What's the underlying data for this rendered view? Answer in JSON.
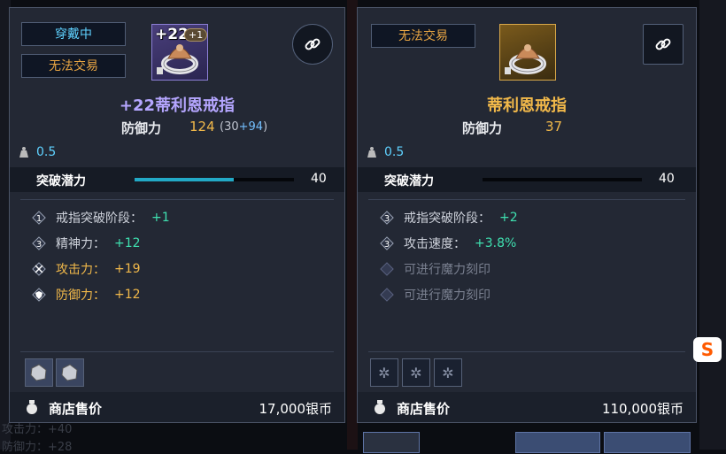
{
  "left_panel": {
    "badge_equipped": "穿戴中",
    "badge_no_trade": "无法交易",
    "icon_enhance": "+22",
    "icon_extra": "+1",
    "item_name": "+22蒂利恩戒指",
    "defense_label": "防御力",
    "defense_value": "124",
    "defense_base": "(30",
    "defense_bonus": "+94",
    "defense_close": ")",
    "weight": "0.5",
    "breakthrough_label": "突破潜力",
    "breakthrough_value": "40",
    "breakthrough_fill": 0.62,
    "options": [
      {
        "icon": "1",
        "label": "戒指突破阶段：",
        "value": "+1"
      },
      {
        "icon": "3",
        "label": "精神力：",
        "value": "+12"
      },
      {
        "icon": "attack-icon",
        "label": "攻击力：",
        "value": "+19"
      },
      {
        "icon": "shield-icon",
        "label": "防御力：",
        "value": "+12"
      }
    ],
    "price_label": "商店售价",
    "price_value": "17,000银币"
  },
  "right_panel": {
    "badge_no_trade": "无法交易",
    "item_name": "蒂利恩戒指",
    "defense_label": "防御力",
    "defense_value": "37",
    "weight": "0.5",
    "breakthrough_label": "突破潜力",
    "breakthrough_value": "40",
    "breakthrough_fill": 0,
    "options": [
      {
        "icon": "3",
        "label": "戒指突破阶段：",
        "value": "+2"
      },
      {
        "icon": "3",
        "label": "攻击速度：",
        "value": "+3.8%"
      },
      {
        "icon": "empty-diamond-icon",
        "label": "可进行魔力刻印",
        "value": ""
      },
      {
        "icon": "empty-diamond-icon",
        "label": "可进行魔力刻印",
        "value": ""
      }
    ],
    "price_label": "商店售价",
    "price_value": "110,000银币"
  },
  "background_ghost": {
    "left_bottom_1": "攻击力：+40",
    "left_bottom_2": "防御力：+28"
  },
  "colors": {
    "accent_cyan": "#5fd2ff",
    "gold": "#f2b94a",
    "purple": "#b5a6ff",
    "green": "#3fe0b0"
  }
}
